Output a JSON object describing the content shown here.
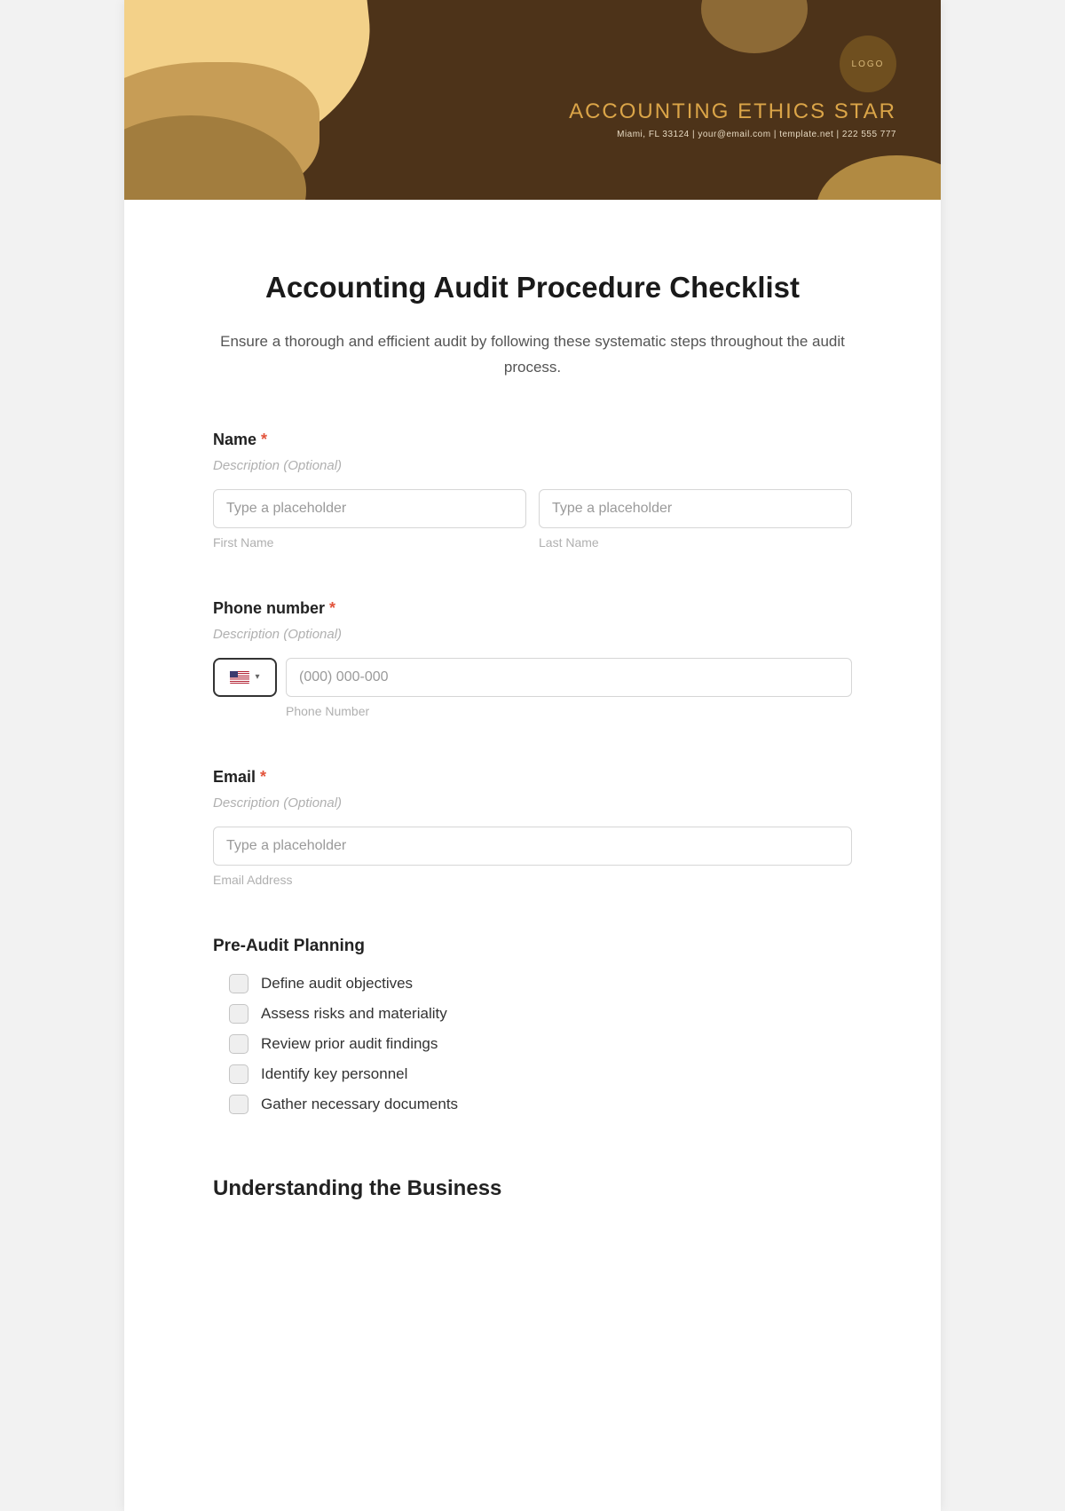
{
  "header": {
    "logo_text": "LOGO",
    "brand_name": "ACCOUNTING ETHICS STAR",
    "brand_sub": "Miami, FL 33124 | your@email.com | template.net | 222 555 777"
  },
  "title": "Accounting Audit Procedure Checklist",
  "subtitle": "Ensure a thorough and efficient audit by following these systematic steps throughout the audit process.",
  "name_field": {
    "label": "Name",
    "desc": "Description (Optional)",
    "first_placeholder": "Type a placeholder",
    "last_placeholder": "Type a placeholder",
    "first_sub": "First Name",
    "last_sub": "Last Name"
  },
  "phone_field": {
    "label": "Phone number",
    "desc": "Description (Optional)",
    "placeholder": "(000) 000-000",
    "sub": "Phone Number"
  },
  "email_field": {
    "label": "Email",
    "desc": "Description (Optional)",
    "placeholder": "Type a placeholder",
    "sub": "Email Address"
  },
  "preaudit": {
    "heading": "Pre-Audit Planning",
    "items": [
      "Define audit objectives",
      "Assess risks and materiality",
      "Review prior audit findings",
      "Identify key personnel",
      "Gather necessary documents"
    ]
  },
  "understanding": {
    "heading": "Understanding the Business"
  }
}
